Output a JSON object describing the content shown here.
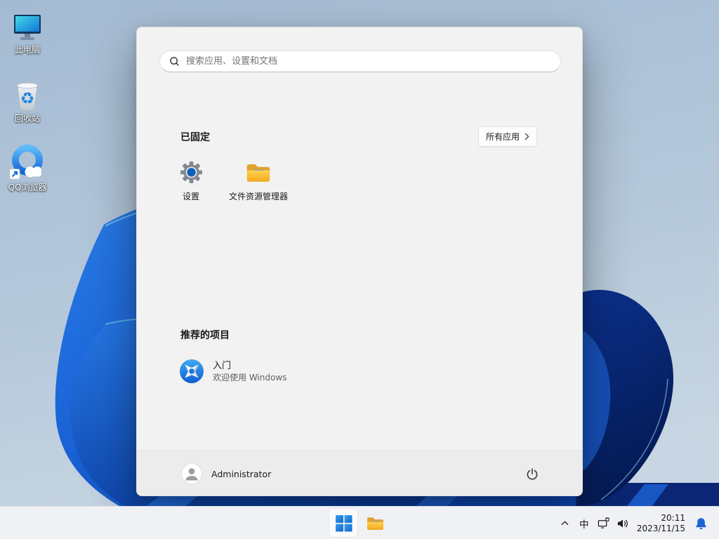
{
  "desktop": {
    "icons": [
      {
        "label": "此电脑"
      },
      {
        "label": "回收站"
      },
      {
        "label": "QQ浏览器"
      }
    ]
  },
  "start_menu": {
    "search_placeholder": "搜索应用、设置和文档",
    "pinned_title": "已固定",
    "all_apps_label": "所有应用",
    "pinned_apps": [
      {
        "label": "设置"
      },
      {
        "label": "文件资源管理器"
      }
    ],
    "recommended_title": "推荐的项目",
    "recommended_items": [
      {
        "title": "入门",
        "subtitle": "欢迎使用 Windows"
      }
    ],
    "user_name": "Administrator"
  },
  "taskbar": {
    "ime_label": "中",
    "time": "20:11",
    "date": "2023/11/15"
  },
  "colors": {
    "accent_blue": "#1e6ee0",
    "bell_blue": "#1f63d2",
    "menu_bg": "#f2f2f2",
    "taskbar_bg": "#eff1f4",
    "wallpaper_sky": "#aec3d8"
  }
}
